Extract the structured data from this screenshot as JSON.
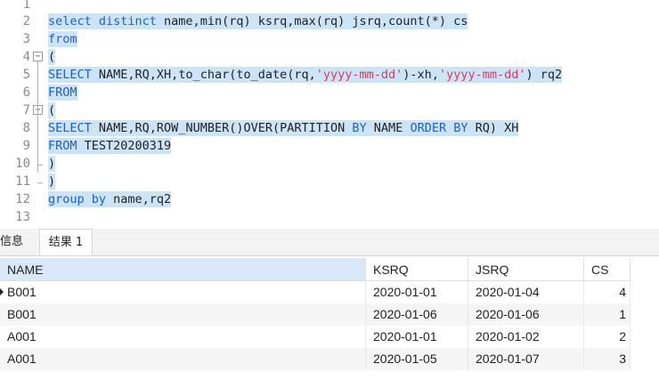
{
  "editor": {
    "line_numbers": [
      "1",
      "2",
      "3",
      "4",
      "5",
      "6",
      "7",
      "8",
      "9",
      "10",
      "11",
      "12",
      "13"
    ],
    "line2": {
      "t1": "select distinct",
      "t2": " name,min(rq) ksrq,max(rq) jsrq,count(*) cs"
    },
    "line3": {
      "t1": "from"
    },
    "line4": {
      "t1": "("
    },
    "line5": {
      "t1": "SELECT",
      "t2": " NAME,RQ,XH,to_char(to_date(rq,",
      "s1": "'yyyy-mm-dd'",
      "t3": ")-xh,",
      "s2": "'yyyy-mm-dd'",
      "t4": ") rq2"
    },
    "line6": {
      "t1": "FROM"
    },
    "line7": {
      "t1": "("
    },
    "line8": {
      "t1": "SELECT",
      "t2": " NAME,RQ,ROW_NUMBER()OVER(PARTITION ",
      "t3": "BY",
      "t4": " NAME ",
      "t5": "ORDER BY",
      "t6": " RQ) XH"
    },
    "line9": {
      "t1": "FROM",
      "t2": " TEST20200319"
    },
    "line10": {
      "t1": ")"
    },
    "line11": {
      "t1": ")"
    },
    "line12": {
      "t1": "group by",
      "t2": " name,rq2"
    },
    "fold_minus": "−"
  },
  "tabs": {
    "info": "信息",
    "result": "结果 1"
  },
  "grid": {
    "columns": [
      "NAME",
      "KSRQ",
      "JSRQ",
      "CS"
    ],
    "rows": [
      [
        "B001",
        "2020-01-01",
        "2020-01-04",
        "4"
      ],
      [
        "B001",
        "2020-01-06",
        "2020-01-06",
        "1"
      ],
      [
        "A001",
        "2020-01-01",
        "2020-01-02",
        "2"
      ],
      [
        "A001",
        "2020-01-05",
        "2020-01-07",
        "3"
      ]
    ]
  },
  "colors": {
    "keyword": "#1c5fd0",
    "string": "#d63c5c",
    "selection": "#cce4f7"
  }
}
